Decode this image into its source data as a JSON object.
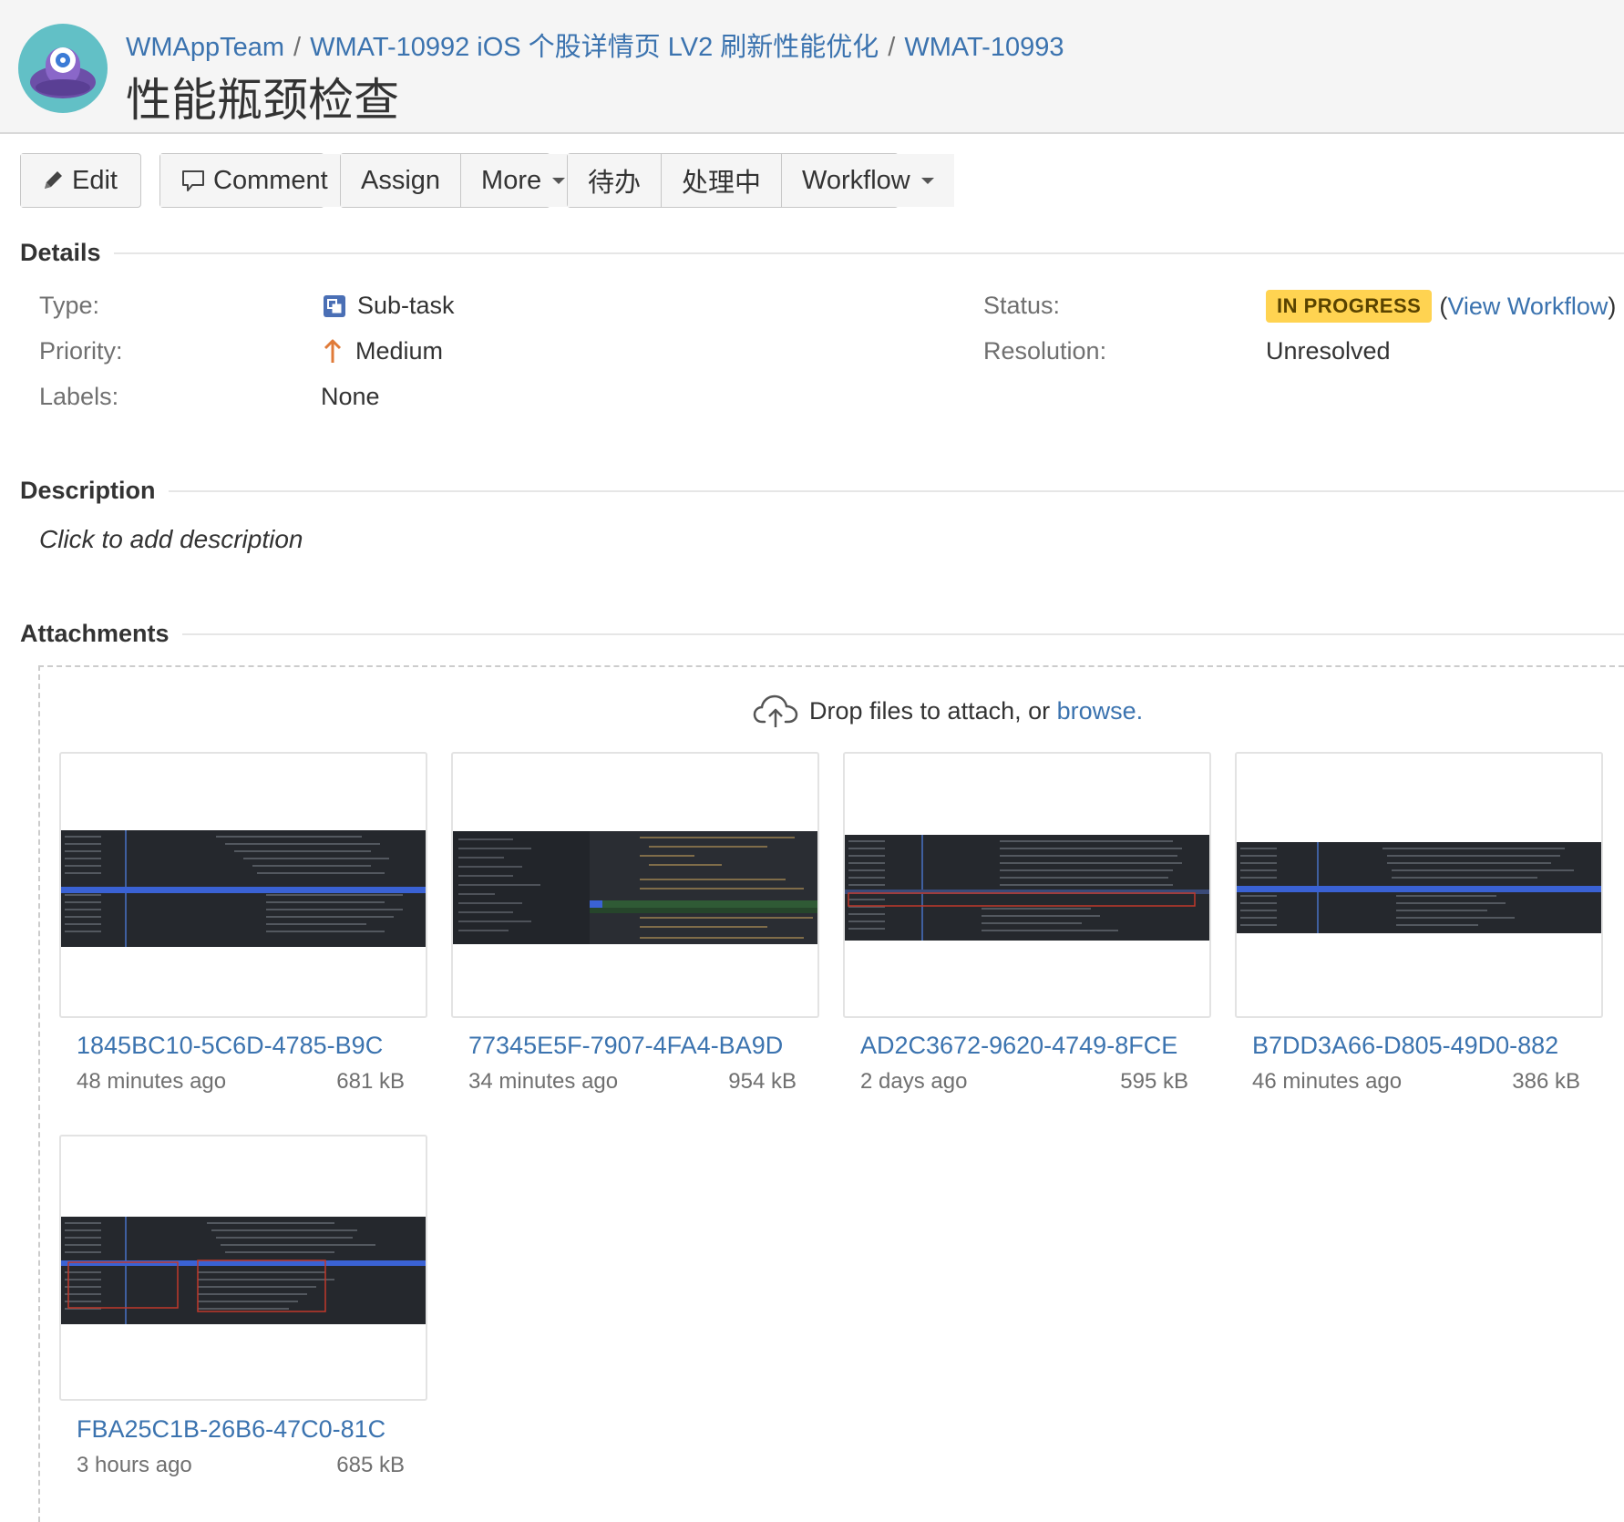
{
  "header": {
    "breadcrumbs": [
      "WMAppTeam",
      "WMAT-10992 iOS 个股详情页 LV2 刷新性能优化",
      "WMAT-10993"
    ],
    "separator": "/",
    "title": "性能瓶颈检查"
  },
  "toolbar": {
    "edit_label": "Edit",
    "comment_label": "Comment",
    "assign_label": "Assign",
    "more_label": "More",
    "todo_label": "待办",
    "in_progress_label": "处理中",
    "workflow_label": "Workflow"
  },
  "details": {
    "heading": "Details",
    "type_label": "Type:",
    "type_value": "Sub-task",
    "priority_label": "Priority:",
    "priority_value": "Medium",
    "labels_label": "Labels:",
    "labels_value": "None",
    "status_label": "Status:",
    "status_value": "IN PROGRESS",
    "view_workflow_open": "(",
    "view_workflow": "View Workflow",
    "view_workflow_close": ")",
    "resolution_label": "Resolution:",
    "resolution_value": "Unresolved"
  },
  "description": {
    "heading": "Description",
    "placeholder": "Click to add description"
  },
  "attachments": {
    "heading": "Attachments",
    "drop_text": "Drop files to attach, or",
    "browse_link": "browse.",
    "items": [
      {
        "name": "1845BC10-5C6D-4785-B9C",
        "time": "48 minutes ago",
        "size": "681 kB"
      },
      {
        "name": "77345E5F-7907-4FA4-BA9D",
        "time": "34 minutes ago",
        "size": "954 kB"
      },
      {
        "name": "AD2C3672-9620-4749-8FCE",
        "time": "2 days ago",
        "size": "595 kB"
      },
      {
        "name": "B7DD3A66-D805-49D0-882",
        "time": "46 minutes ago",
        "size": "386 kB"
      },
      {
        "name": "FBA25C1B-26B6-47C0-81C",
        "time": "3 hours ago",
        "size": "685 kB"
      }
    ]
  },
  "colors": {
    "link": "#3b73af",
    "status_bg": "#ffd351",
    "priority_arrow": "#e07b39",
    "subtask_icon": "#4a6fb5"
  },
  "icons": {
    "avatar": "project-avatar-icon",
    "edit": "pencil-icon",
    "comment": "speech-bubble-icon",
    "type": "subtask-icon",
    "priority": "arrow-up-icon",
    "upload": "cloud-upload-icon"
  }
}
